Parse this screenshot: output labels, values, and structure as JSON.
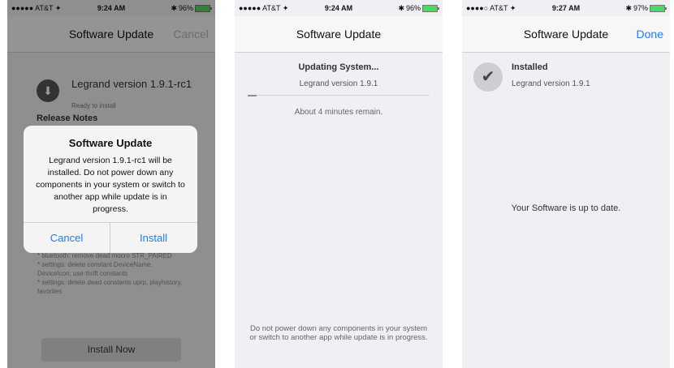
{
  "screen1": {
    "status": {
      "carrier": "●●●●● AT&T ✦",
      "time": "9:24 AM",
      "battery": "96%"
    },
    "nav_title": "Software Update",
    "nav_cancel": "Cancel",
    "package": {
      "icon": "download-icon",
      "title": "Legrand version 1.9.1-rc1",
      "status": "Ready to install"
    },
    "release_notes_label": "Release Notes",
    "notes": [
      "* bluetooth: remove dead mocro STR_PAIRED",
      "* settings: delete constant DeviceName, DeviceIcon, use thrift constants",
      "* settings: delete dead constants uprp, playhistory, favorites"
    ],
    "install_now_label": "Install Now",
    "alert": {
      "title": "Software Update",
      "message": "Legrand version 1.9.1-rc1 will be installed. Do not power down any components in your system or switch to another app while update is in progress.",
      "cancel_label": "Cancel",
      "install_label": "Install"
    }
  },
  "screen2": {
    "status": {
      "carrier": "●●●●● AT&T ✦",
      "time": "9:24 AM",
      "battery": "96%"
    },
    "nav_title": "Software Update",
    "updating_title": "Updating System...",
    "version": "Legrand version 1.9.1",
    "progress": 0.05,
    "remaining": "About 4 minutes remain.",
    "warning": "Do not power down any components in your system or switch to another app while update is in progress."
  },
  "screen3": {
    "status": {
      "carrier": "●●●●○ AT&T ✦",
      "time": "9:27 AM",
      "battery": "97%"
    },
    "nav_title": "Software Update",
    "nav_done": "Done",
    "check_icon": "checkmark-icon",
    "installed_title": "Installed",
    "version": "Legrand version 1.9.1",
    "uptodate": "Your Software is up to date."
  },
  "colors": {
    "accent": "#1b7ef5",
    "battery": "#4cd964",
    "background": "#efeff4"
  }
}
